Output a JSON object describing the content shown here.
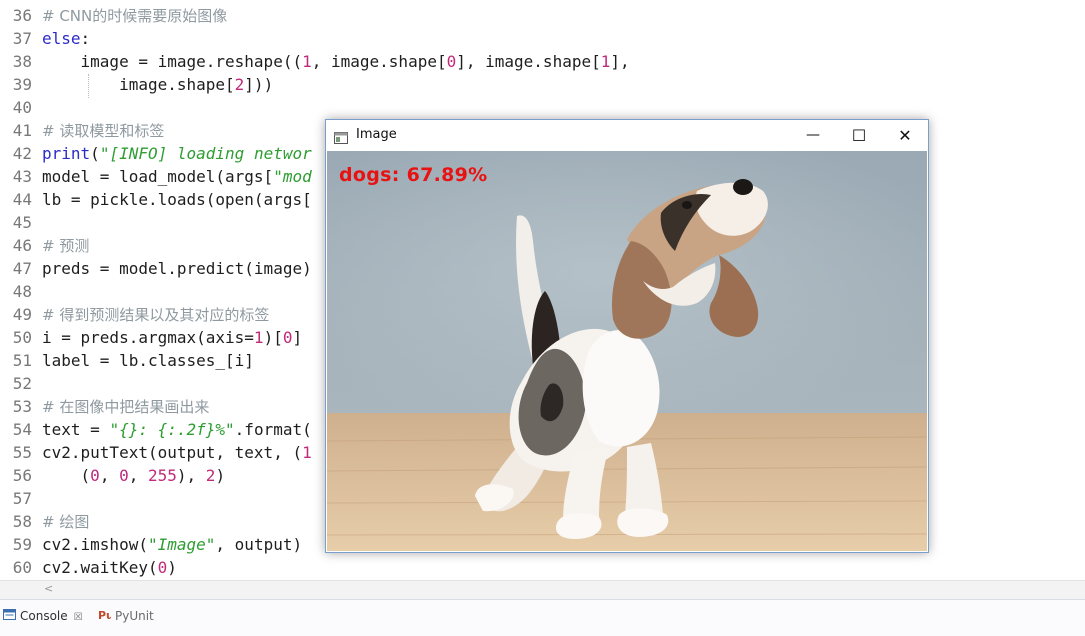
{
  "editor": {
    "lines": [
      {
        "n": "36",
        "t": "comment",
        "c": "# CNN的时候需要原始图像"
      },
      {
        "n": "37",
        "t": "code",
        "c": "else:"
      },
      {
        "n": "38",
        "t": "code",
        "c": "    image = image.reshape((1, image.shape[0], image.shape[1],"
      },
      {
        "n": "39",
        "t": "code",
        "c": "        image.shape[2]))"
      },
      {
        "n": "40",
        "t": "code",
        "c": ""
      },
      {
        "n": "41",
        "t": "comment",
        "c": "# 读取模型和标签"
      },
      {
        "n": "42",
        "t": "code",
        "c": "print(\"[INFO] loading networ"
      },
      {
        "n": "43",
        "t": "code",
        "c": "model = load_model(args[\"mod"
      },
      {
        "n": "44",
        "t": "code",
        "c": "lb = pickle.loads(open(args["
      },
      {
        "n": "45",
        "t": "code",
        "c": ""
      },
      {
        "n": "46",
        "t": "comment",
        "c": "# 预测"
      },
      {
        "n": "47",
        "t": "code",
        "c": "preds = model.predict(image)"
      },
      {
        "n": "48",
        "t": "code",
        "c": ""
      },
      {
        "n": "49",
        "t": "comment",
        "c": "# 得到预测结果以及其对应的标签"
      },
      {
        "n": "50",
        "t": "code",
        "c": "i = preds.argmax(axis=1)[0]"
      },
      {
        "n": "51",
        "t": "code",
        "c": "label = lb.classes_[i]"
      },
      {
        "n": "52",
        "t": "code",
        "c": ""
      },
      {
        "n": "53",
        "t": "comment",
        "c": "# 在图像中把结果画出来"
      },
      {
        "n": "54",
        "t": "code",
        "c": "text = \"{}: {:.2f}%\".format("
      },
      {
        "n": "55",
        "t": "code",
        "c": "cv2.putText(output, text, (1"
      },
      {
        "n": "56",
        "t": "code",
        "c": "    (0, 0, 255), 2)"
      },
      {
        "n": "57",
        "t": "code",
        "c": ""
      },
      {
        "n": "58",
        "t": "comment",
        "c": "# 绘图"
      },
      {
        "n": "59",
        "t": "code",
        "c": "cv2.imshow(\"Image\", output)"
      },
      {
        "n": "60",
        "t": "code",
        "c": "cv2.waitKey(0)"
      }
    ]
  },
  "console_tabs": {
    "console_label": "Console",
    "console_close": "☒",
    "pyunit_label": "PyUnit",
    "scroll_arrow": "<"
  },
  "image_window": {
    "title": "Image",
    "minimize": "—",
    "maximize": "☐",
    "close": "✕",
    "overlay_text": "dogs: 67.89%"
  },
  "colors": {
    "keyword": "#2b2bc8",
    "string": "#2e9d32",
    "number": "#c02a7a",
    "comment": "#8f9aa0",
    "overlay": "#e81212"
  }
}
